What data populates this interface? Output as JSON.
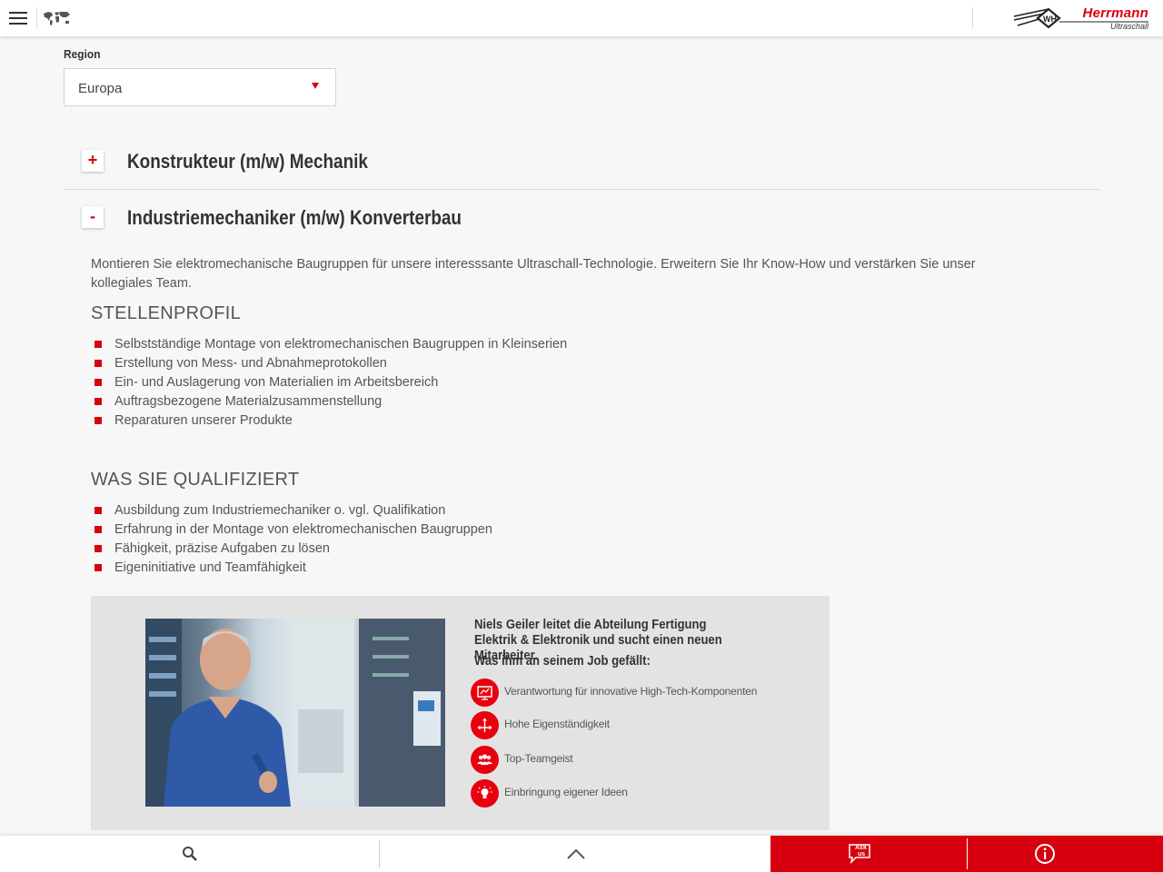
{
  "header": {
    "menu_icon": "hamburger-menu-icon",
    "world_icon": "world-map-icon",
    "logo": {
      "brand": "Herrmann",
      "sub": "Ultraschall",
      "mark": "WH"
    }
  },
  "region": {
    "label": "Region",
    "selected": "Europa"
  },
  "jobs": [
    {
      "toggle": "+",
      "title": "Konstrukteur (m/w) Mechanik"
    },
    {
      "toggle": "-",
      "title": "Industriemechaniker (m/w) Konverterbau"
    }
  ],
  "detail": {
    "intro": "Montieren Sie elektromechanische Baugruppen für unsere interesssante Ultraschall-Technologie. Erweitern Sie Ihr Know-How und verstärken Sie unser kollegiales Team.",
    "profile_heading": "STELLENPROFIL",
    "profile_items": [
      "Selbstständige Montage von elektromechanischen Baugruppen in Kleinserien",
      "Erstellung von Mess- und Abnahmeprotokollen",
      "Ein- und Auslagerung von Materialien im Arbeitsbereich",
      "Auftragsbezogene Materialzusammenstellung",
      "Reparaturen unserer Produkte"
    ],
    "qual_heading": "WAS SIE QUALIFIZIERT",
    "qual_items": [
      "Ausbildung zum Industriemechaniker o. vgl. Qualifikation",
      "Erfahrung in der Montage von elektromechanischen Baugruppen",
      "Fähigkeit, präzise Aufgaben zu lösen",
      "Eigeninitiative und Teamfähigkeit"
    ]
  },
  "feature": {
    "title": "Niels Geiler leitet die Abteilung Fertigung Elektrik & Elektronik und sucht einen neuen Mitarbeiter.",
    "subtitle": "Was ihm an seinem Job gefällt:",
    "items": [
      {
        "icon": "presentation-chart-icon",
        "label": "Verantwortung für innovative High-Tech-Komponenten"
      },
      {
        "icon": "move-arrows-icon",
        "label": "Hohe Eigenständigkeit"
      },
      {
        "icon": "team-people-icon",
        "label": "Top-Teamgeist"
      },
      {
        "icon": "lightbulb-idea-icon",
        "label": "Einbringung eigener Ideen"
      }
    ]
  },
  "bottombar": {
    "search_icon": "search-icon",
    "up_icon": "chevron-up-icon",
    "ask_label": "Ask us",
    "ask_line1": "Ask",
    "ask_line2": "us",
    "info_icon": "info-icon"
  },
  "colors": {
    "accent": "#d7000f",
    "background": "#f7f7f7",
    "feature_bg": "#e3e3e3"
  }
}
